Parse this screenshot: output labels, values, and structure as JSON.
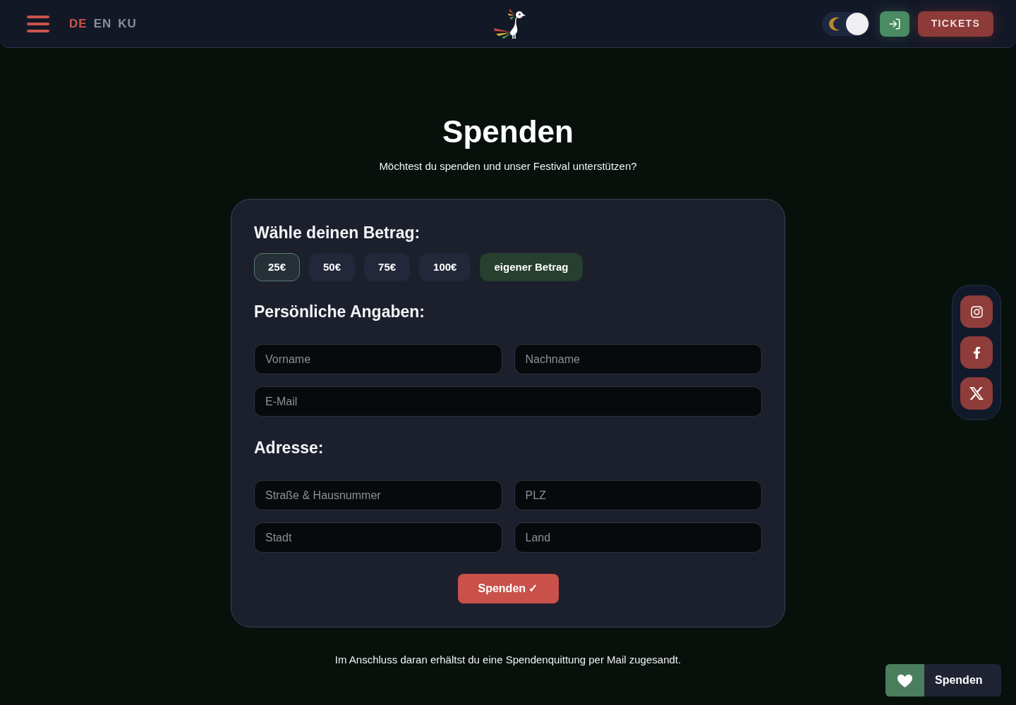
{
  "header": {
    "languages": [
      {
        "code": "DE",
        "selected": true
      },
      {
        "code": "EN",
        "selected": false
      },
      {
        "code": "KU",
        "selected": false
      }
    ],
    "theme_toggle": {
      "dark_mode": true
    },
    "tickets_button": "TICKETS"
  },
  "title": "Spenden",
  "subtitle": "Möchtest du spenden und unser Festival unterstützen?",
  "donation_form": {
    "amount_heading": "Wähle deinen Betrag:",
    "amounts": [
      {
        "label": "25€",
        "kind": "preset",
        "selected": true
      },
      {
        "label": "50€",
        "kind": "preset",
        "selected": false
      },
      {
        "label": "75€",
        "kind": "preset",
        "selected": false
      },
      {
        "label": "100€",
        "kind": "preset",
        "selected": false
      },
      {
        "label": "eigener Betrag",
        "kind": "custom",
        "selected": false
      }
    ],
    "sections": [
      {
        "heading": "Persönliche Angaben:",
        "rows": [
          {
            "fields": [
              {
                "placeholder": "Vorname"
              },
              {
                "placeholder": "Nachname"
              }
            ]
          },
          {
            "fields": [
              {
                "placeholder": "E-Mail"
              }
            ]
          }
        ]
      },
      {
        "heading": "Adresse:",
        "rows": [
          {
            "fields": [
              {
                "placeholder": "Straße & Hausnummer"
              },
              {
                "placeholder": "PLZ"
              }
            ]
          },
          {
            "fields": [
              {
                "placeholder": "Stadt"
              },
              {
                "placeholder": "Land"
              }
            ]
          }
        ]
      }
    ],
    "submit_button": "Spenden ✓"
  },
  "note": "Im Anschluss daran erhältst du eine Spendenquittung per Mail zugesandt.",
  "social_links": [
    {
      "kind": "instagram"
    },
    {
      "kind": "facebook"
    },
    {
      "kind": "x"
    }
  ],
  "donate_tab": {
    "label": "Spenden"
  }
}
